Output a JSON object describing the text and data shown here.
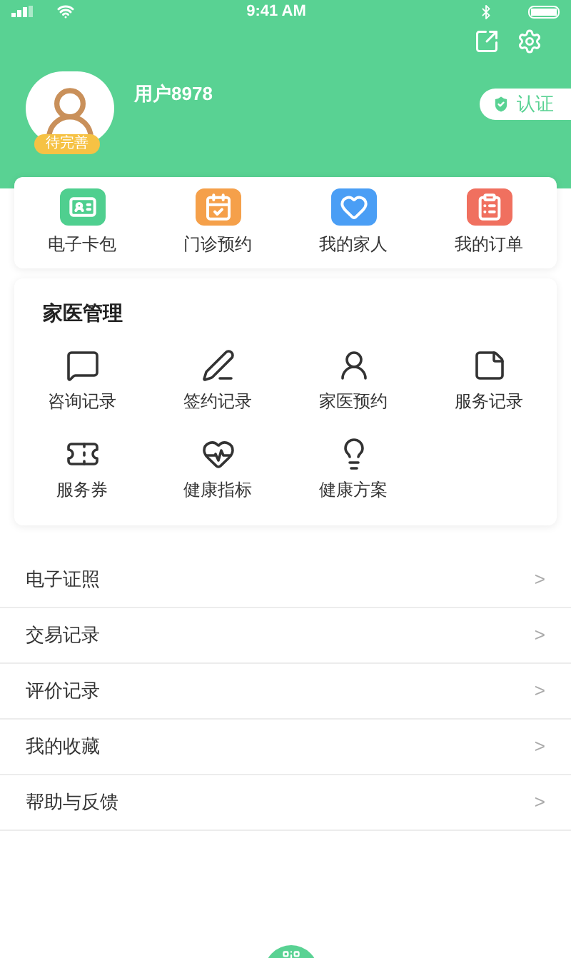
{
  "status_bar": {
    "time": "9:41 AM"
  },
  "profile": {
    "username": "用户8978",
    "avatar_badge": "待完善",
    "verify_button": "认证"
  },
  "shortcuts": [
    {
      "kind": "card",
      "label": "电子卡包",
      "color": "#4fcf8f"
    },
    {
      "kind": "calendar",
      "label": "门诊预约",
      "color": "#f5a04a"
    },
    {
      "kind": "heart",
      "label": "我的家人",
      "color": "#4a9ef5"
    },
    {
      "kind": "clipboard",
      "label": "我的订单",
      "color": "#f0705f"
    }
  ],
  "family_doctor": {
    "title": "家医管理",
    "items": [
      {
        "kind": "chat",
        "label": "咨询记录"
      },
      {
        "kind": "pen",
        "label": "签约记录"
      },
      {
        "kind": "nurse",
        "label": "家医预约"
      },
      {
        "kind": "note",
        "label": "服务记录"
      },
      {
        "kind": "ticket",
        "label": "服务券"
      },
      {
        "kind": "health",
        "label": "健康指标"
      },
      {
        "kind": "bulb",
        "label": "健康方案"
      }
    ]
  },
  "menu": [
    {
      "label": "电子证照",
      "chevron": ">"
    },
    {
      "label": "交易记录",
      "chevron": ">"
    },
    {
      "label": "评价记录",
      "chevron": ">"
    },
    {
      "label": "我的收藏",
      "chevron": ">"
    },
    {
      "label": "帮助与反馈",
      "chevron": ">"
    }
  ]
}
